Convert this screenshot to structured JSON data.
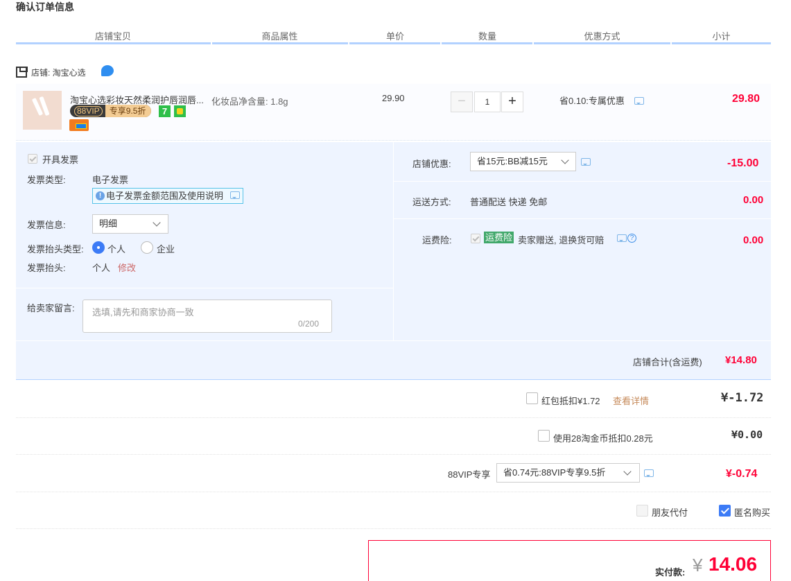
{
  "title": "确认订单信息",
  "columns": [
    "店铺宝贝",
    "商品属性",
    "单价",
    "数量",
    "优惠方式",
    "小计"
  ],
  "shop": {
    "label": "店铺: 淘宝心选"
  },
  "item": {
    "name": "淘宝心选彩妆天然柔润护唇润唇...",
    "vip_label": "88VIP",
    "vip_discount": "专享9.5折",
    "attribute": "化妆品净含量: 1.8g",
    "unit_price": "29.90",
    "quantity": "1",
    "minus": "−",
    "plus": "+",
    "promo": "省0.10:专属优惠",
    "subtotal": "29.80",
    "badge7": "7"
  },
  "invoice": {
    "open_label": "开具发票",
    "type_label": "发票类型:",
    "type_value": "电子发票",
    "note": "电子发票金额范围及使用说明",
    "info_label": "发票信息:",
    "info_value": "明细",
    "title_type_label": "发票抬头类型:",
    "personal": "个人",
    "company": "企业",
    "title_label": "发票抬头:",
    "title_value": "个人",
    "modify": "修改"
  },
  "message": {
    "label": "给卖家留言:",
    "placeholder": "选填,请先和商家协商一致",
    "counter": "0/200"
  },
  "shop_discount": {
    "label": "店铺优惠:",
    "value": "省15元:BB减15元",
    "amount": "-15.00"
  },
  "shipping": {
    "label": "运送方式:",
    "value": "普通配送 快递 免邮",
    "amount": "0.00"
  },
  "insurance": {
    "label": "运费险:",
    "tag": "运费险",
    "desc": "卖家赠送, 退换货可赔",
    "amount": "0.00"
  },
  "shop_total": {
    "label": "店铺合计(含运费)",
    "amount": "¥14.80"
  },
  "red_packet": {
    "label": "红包抵扣¥1.72",
    "link": "查看详情",
    "amount": "¥-1.72"
  },
  "coins": {
    "label": "使用28淘金币抵扣0.28元",
    "amount": "¥0.00"
  },
  "vip": {
    "label": "88VIP专享",
    "value": "省0.74元:88VIP专享9.5折",
    "amount": "¥-0.74"
  },
  "options": {
    "friend_pay": "朋友代付",
    "anonymous": "匿名购买"
  },
  "pay": {
    "label": "实付款:",
    "currency": "¥",
    "amount": "14.06"
  },
  "colors": {
    "accent": "#ff0036",
    "blue": "#3c7bf6",
    "panel": "#eef4ff"
  }
}
